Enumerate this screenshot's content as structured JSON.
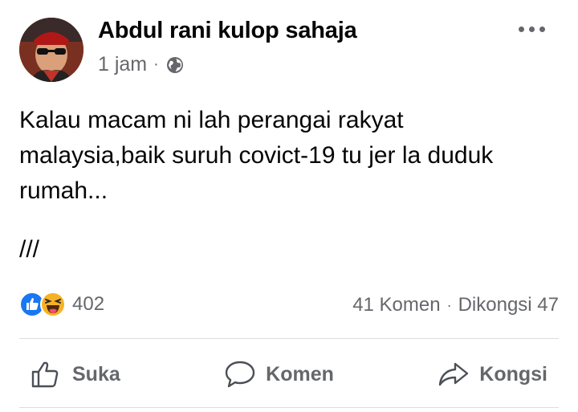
{
  "post": {
    "author": "Abdul rani kulop sahaja",
    "time": "1 jam",
    "separator": "·",
    "privacy_icon": "globe-icon",
    "body": "Kalau macam ni lah perangai rakyat\nmalaysia,baik suruh covict-19 tu jer la duduk\nrumah...",
    "extra": "///"
  },
  "reactions": {
    "icons": [
      "like-icon",
      "haha-icon"
    ],
    "count": "402",
    "comments": "41 Komen",
    "shares": "Dikongsi 47"
  },
  "actions": [
    {
      "label": "Suka",
      "icon": "thumbs-up-icon"
    },
    {
      "label": "Komen",
      "icon": "comment-icon"
    },
    {
      "label": "Kongsi",
      "icon": "share-icon"
    }
  ],
  "colors": {
    "like_blue": "#1877f2",
    "haha_yellow": "#f7b125",
    "secondary_text": "#65676b"
  }
}
